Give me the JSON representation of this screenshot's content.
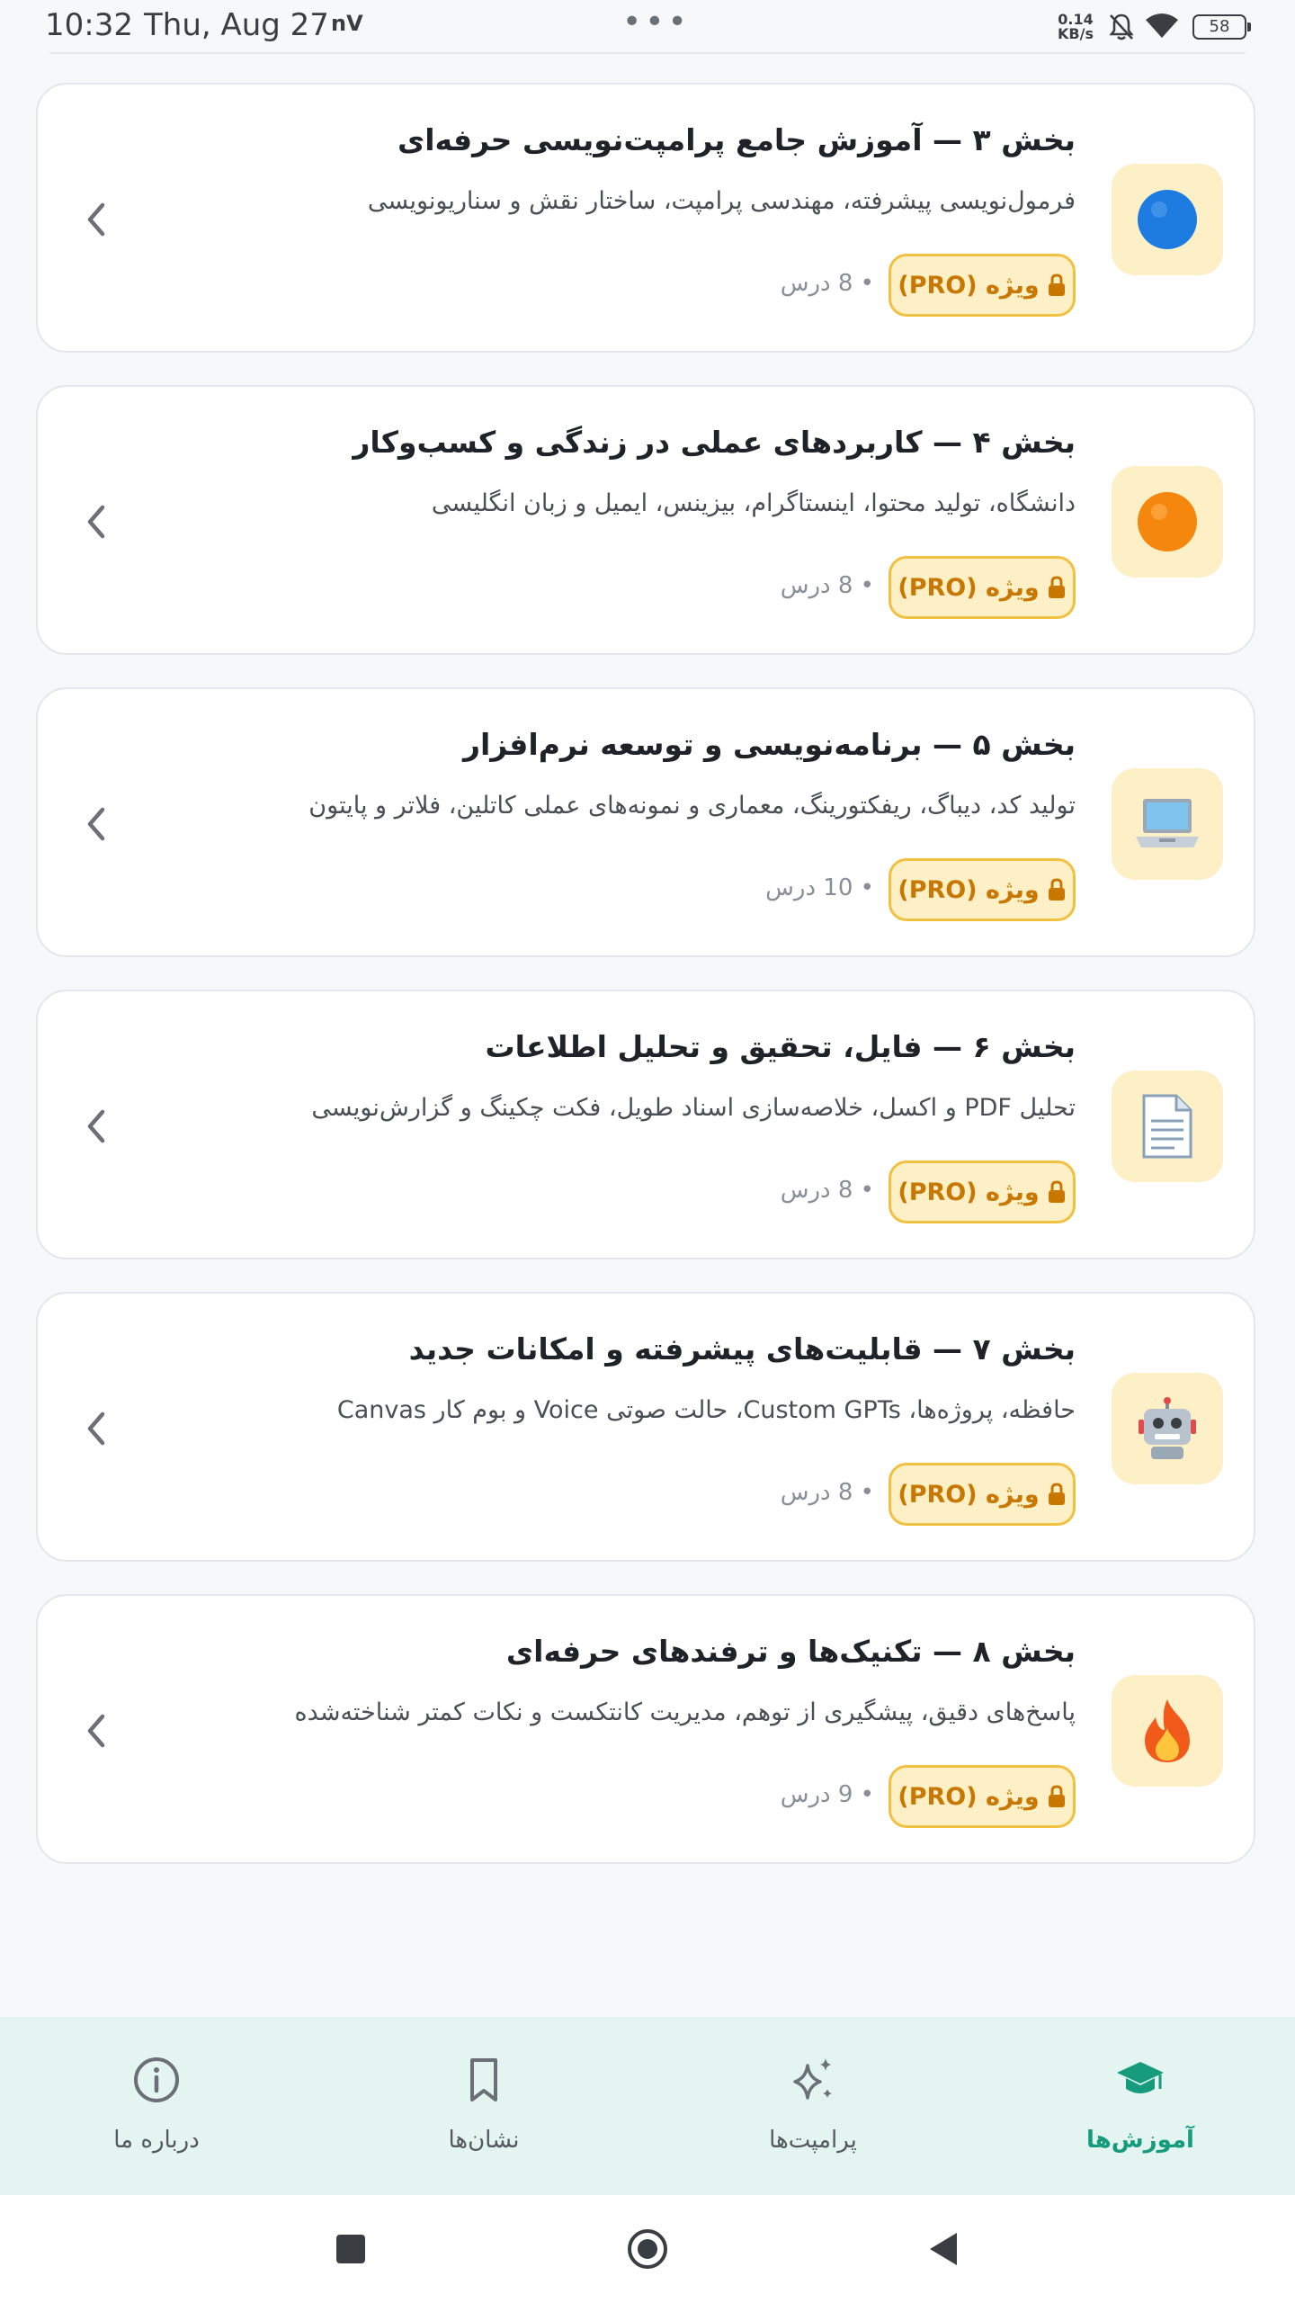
{
  "status_bar": {
    "time": "10:32",
    "date": "Thu, Aug 27",
    "carrier_icon_text": "nV",
    "more_dots": "•••",
    "net_speed_value": "0.14",
    "net_speed_unit": "KB/s",
    "battery": "58"
  },
  "sections": [
    {
      "title": "بخش ۳ — آموزش جامع پرامپت‌نویسی حرفه‌ای",
      "description": "فرمول‌نویسی پیشرفته، مهندسی پرامپت، ساختار نقش و سناریونویسی",
      "badge": "ویژه (PRO)",
      "lessons": "8 درس",
      "icon": "blue-circle-emoji",
      "emoji": "🔵",
      "emoji_color": "#1e7be0"
    },
    {
      "title": "بخش ۴ — کاربردهای عملی در زندگی و کسب‌وکار",
      "description": "دانشگاه، تولید محتوا، اینستاگرام، بیزینس، ایمیل و زبان انگلیسی",
      "badge": "ویژه (PRO)",
      "lessons": "8 درس",
      "icon": "orange-circle-emoji",
      "emoji": "🟠",
      "emoji_color": "#f5870f"
    },
    {
      "title": "بخش ۵ — برنامه‌نویسی و توسعه نرم‌افزار",
      "description": "تولید کد، دیباگ، ریفکتورینگ، معماری و نمونه‌های عملی کاتلین، فلاتر و پایتون",
      "badge": "ویژه (PRO)",
      "lessons": "10 درس",
      "icon": "laptop-emoji",
      "emoji": "💻",
      "emoji_color": "#6a7a8c"
    },
    {
      "title": "بخش ۶ — فایل، تحقیق و تحلیل اطلاعات",
      "description": "تحلیل PDF و اکسل، خلاصه‌سازی اسناد طویل، فکت چکینگ و گزارش‌نویسی",
      "badge": "ویژه (PRO)",
      "lessons": "8 درس",
      "icon": "document-emoji",
      "emoji": "📄",
      "emoji_color": "#8aa0b8"
    },
    {
      "title": "بخش ۷ — قابلیت‌های پیشرفته و امکانات جدید",
      "description": "حافظه، پروژه‌ها، Custom GPTs، حالت صوتی Voice و بوم کار Canvas",
      "badge": "ویژه (PRO)",
      "lessons": "8 درس",
      "icon": "robot-emoji",
      "emoji": "🤖",
      "emoji_color": "#7d8a99"
    },
    {
      "title": "بخش ۸ — تکنیک‌ها و ترفندهای حرفه‌ای",
      "description": "پاسخ‌های دقیق، پیشگیری از توهم، مدیریت کانتکست و نکات کمتر شناخته‌شده",
      "badge": "ویژه (PRO)",
      "lessons": "9 درس",
      "icon": "fire-emoji",
      "emoji": "🔥",
      "emoji_color": "#f25a1c"
    }
  ],
  "bottom_nav": [
    {
      "label": "درباره ما",
      "icon": "info-icon",
      "active": false
    },
    {
      "label": "نشان‌ها",
      "icon": "bookmark-icon",
      "active": false
    },
    {
      "label": "پرامپت‌ها",
      "icon": "sparkles-icon",
      "active": false
    },
    {
      "label": "آموزش‌ها",
      "icon": "graduation-cap-icon",
      "active": true
    }
  ],
  "colors": {
    "accent_green": "#169c7c",
    "pro_badge_bg": "#fdf0c6",
    "pro_badge_border": "#f0c040",
    "pro_badge_text": "#c87800",
    "nav_bg": "#e4f4f1"
  }
}
